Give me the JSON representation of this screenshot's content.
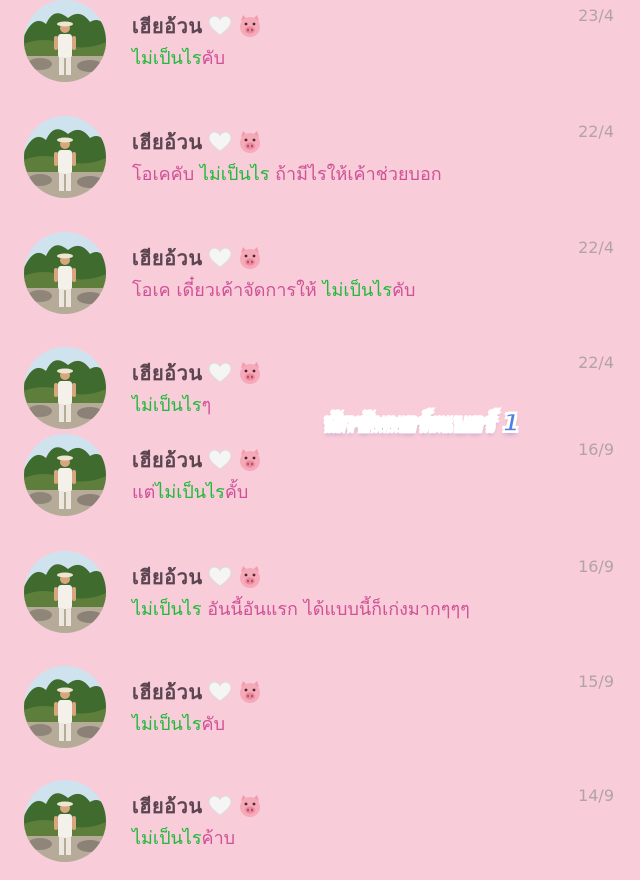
{
  "colors": {
    "background": "#f9ccd9",
    "name": "#5a4550",
    "green_text": "#1fb93b",
    "pink_text": "#cf5196",
    "date": "#b3a2aa",
    "overlay": "#4f7fe0"
  },
  "overlay_label": "นักซัพพอร์ตเบอร์ 1",
  "messages": [
    {
      "name": "เฮียอ้วน",
      "name_icons": [
        "white-heart-icon",
        "pig-face-icon"
      ],
      "date": "23/4",
      "segments": [
        {
          "text": "ไม่เป็นไร",
          "color": "green"
        },
        {
          "text": "คับ",
          "color": "pink"
        }
      ]
    },
    {
      "name": "เฮียอ้วน",
      "name_icons": [
        "white-heart-icon",
        "pig-face-icon"
      ],
      "date": "22/4",
      "segments": [
        {
          "text": "โอเคคับ ",
          "color": "pink"
        },
        {
          "text": "ไม่เป็นไร",
          "color": "green"
        },
        {
          "text": " ถ้ามีไรให้เค้าช่วยบอก",
          "color": "pink"
        }
      ]
    },
    {
      "name": "เฮียอ้วน",
      "name_icons": [
        "white-heart-icon",
        "pig-face-icon"
      ],
      "date": "22/4",
      "segments": [
        {
          "text": "โอเค เดี๋ยวเค้าจัดการให้ ",
          "color": "pink"
        },
        {
          "text": "ไม่เป็นไร",
          "color": "green"
        },
        {
          "text": "คับ",
          "color": "pink"
        }
      ]
    },
    {
      "name": "เฮียอ้วน",
      "name_icons": [
        "white-heart-icon",
        "pig-face-icon"
      ],
      "date": "22/4",
      "segments": [
        {
          "text": "ไม่เป็นไร",
          "color": "green"
        },
        {
          "text": "ๆ",
          "color": "pink"
        }
      ]
    },
    {
      "name": "เฮียอ้วน",
      "name_icons": [
        "white-heart-icon",
        "pig-face-icon"
      ],
      "date": "16/9",
      "segments": [
        {
          "text": "แต่",
          "color": "pink"
        },
        {
          "text": "ไม่เป็นไร",
          "color": "green"
        },
        {
          "text": "คั้บ",
          "color": "pink"
        }
      ]
    },
    {
      "name": "เฮียอ้วน",
      "name_icons": [
        "white-heart-icon",
        "pig-face-icon"
      ],
      "date": "16/9",
      "segments": [
        {
          "text": "ไม่เป็นไร",
          "color": "green"
        },
        {
          "text": " อันนี้อันแรก ได้แบบนี้ก็เก่งมากๆๆๆ",
          "color": "pink"
        }
      ]
    },
    {
      "name": "เฮียอ้วน",
      "name_icons": [
        "white-heart-icon",
        "pig-face-icon"
      ],
      "date": "15/9",
      "segments": [
        {
          "text": "ไม่เป็นไร",
          "color": "green"
        },
        {
          "text": "คับ",
          "color": "pink"
        }
      ]
    },
    {
      "name": "เฮียอ้วน",
      "name_icons": [
        "white-heart-icon",
        "pig-face-icon"
      ],
      "date": "14/9",
      "segments": [
        {
          "text": "ไม่เป็นไร",
          "color": "green"
        },
        {
          "text": "ค้าบ",
          "color": "pink"
        }
      ]
    }
  ]
}
